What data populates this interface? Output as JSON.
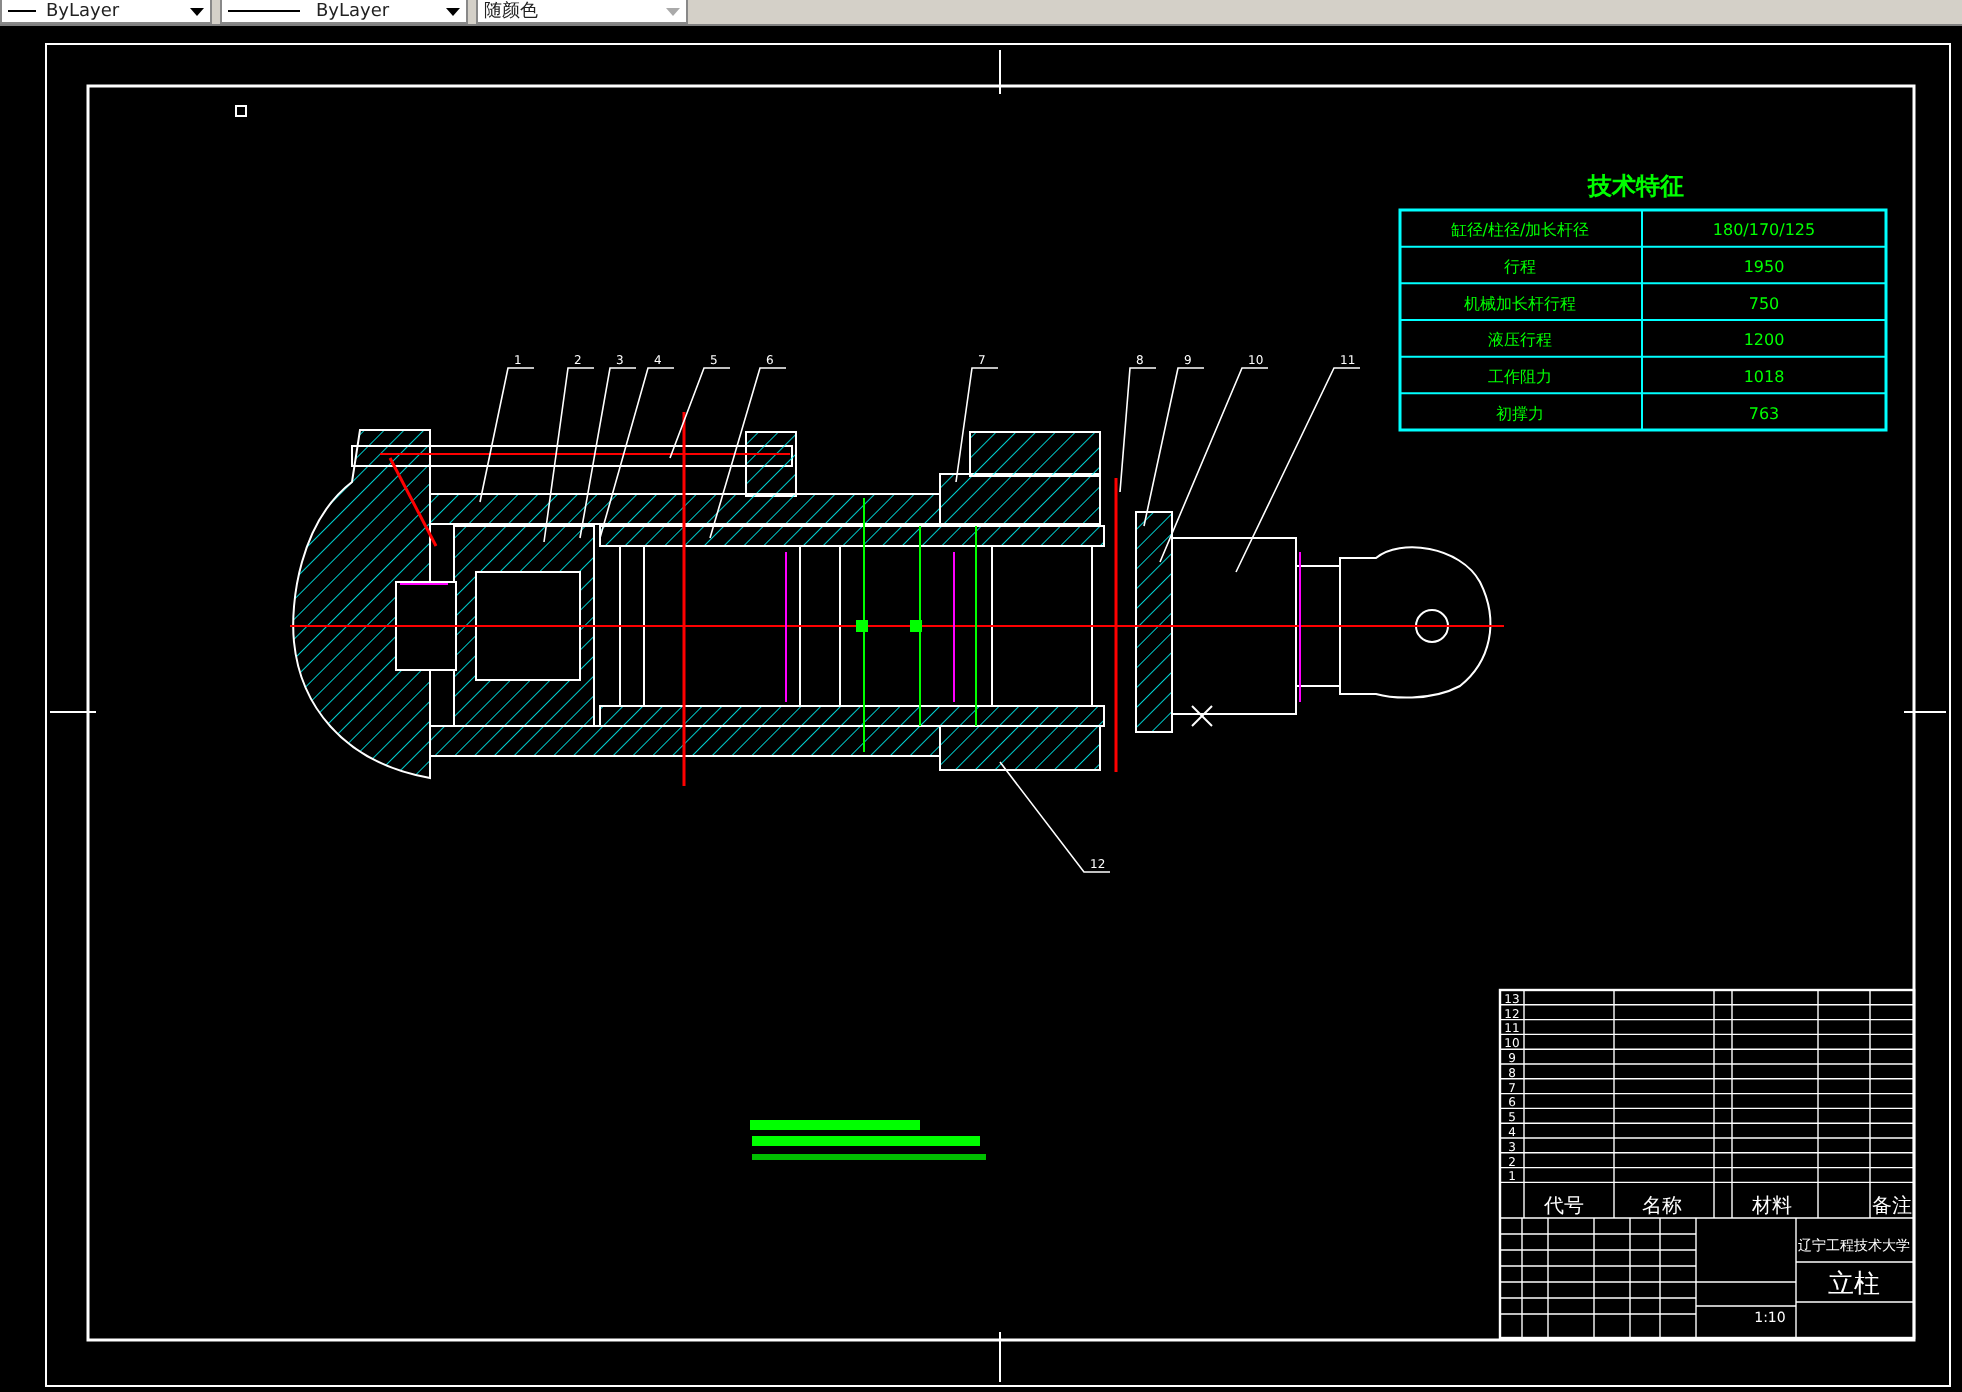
{
  "toolbar": {
    "linetype": "ByLayer",
    "lineweight": "ByLayer",
    "color_setting": "随颜色"
  },
  "tech_table": {
    "title": "技术特征",
    "rows": [
      {
        "label": "缸径/柱径/加长杆径",
        "value": "180/170/125"
      },
      {
        "label": "行程",
        "value": "1950"
      },
      {
        "label": "机械加长杆行程",
        "value": "750"
      },
      {
        "label": "液压行程",
        "value": "1200"
      },
      {
        "label": "工作阻力",
        "value": "1018"
      },
      {
        "label": "初撑力",
        "value": "763"
      }
    ]
  },
  "part_labels": [
    "1",
    "2",
    "3",
    "4",
    "5",
    "6",
    "7",
    "8",
    "9",
    "10",
    "11",
    "12"
  ],
  "parts_list": {
    "rows": [
      "13",
      "12",
      "11",
      "10",
      "9",
      "8",
      "7",
      "6",
      "5",
      "4",
      "3",
      "2",
      "1"
    ],
    "headers": [
      "代号",
      "名称",
      "材料",
      "备注"
    ]
  },
  "title_block": {
    "school": "辽宁工程技术大学",
    "drawing_title": "立柱",
    "scale": "1:10"
  }
}
